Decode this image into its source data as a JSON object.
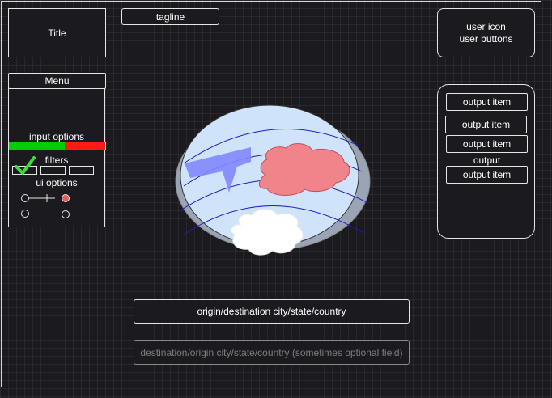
{
  "header": {
    "title": "Title",
    "tagline": "tagline",
    "user_icon_label": "user icon",
    "user_buttons_label": "user buttons"
  },
  "sidebar": {
    "menu_label": "Menu",
    "input_options_label": "input options",
    "filters_label": "filters",
    "ui_options_label": "ui options",
    "progress_fraction": 0.58,
    "colors": {
      "progress_fill": "#00cc00",
      "progress_rest": "#ff1a1a",
      "checkmark": "#3ddc3d",
      "radio_selected": "#e85c5c"
    }
  },
  "output_panel": {
    "items": [
      "output item",
      "output item",
      "output item"
    ],
    "output_label": "output",
    "last_item": "output item"
  },
  "globe": {
    "icon_name": "globe-illustration-icon",
    "colors": {
      "sphere": "#cfe4fb",
      "continent": "#f0848a",
      "plane": "#7f88ff",
      "cloud": "#ffffff",
      "orbit": "#1d1dcc"
    }
  },
  "form": {
    "origin_value": "origin/destination city/state/country",
    "destination_placeholder": "destination/origin city/state/country (sometimes optional field)"
  }
}
